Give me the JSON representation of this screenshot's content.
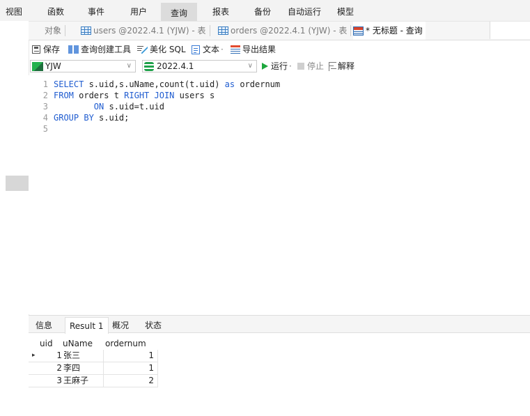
{
  "menubar": {
    "items": [
      "视图",
      "函数",
      "事件",
      "用户",
      "查询",
      "报表",
      "备份",
      "自动运行",
      "模型"
    ],
    "active_index": 4
  },
  "tabs": {
    "object_label": "对象",
    "items": [
      {
        "label": "users @2022.4.1 (YJW) - 表",
        "icon": "table-icon"
      },
      {
        "label": "orders @2022.4.1 (YJW) - 表",
        "icon": "table-icon"
      },
      {
        "label": "* 无标题 - 查询",
        "icon": "query-icon"
      }
    ]
  },
  "toolbar": {
    "save": "保存",
    "query_builder": "查询创建工具",
    "beautify": "美化 SQL",
    "text": "文本",
    "export": "导出结果"
  },
  "connection": {
    "connection_value": "YJW",
    "database_value": "2022.4.1",
    "run": "运行",
    "stop": "停止",
    "explain": "解释"
  },
  "editor": {
    "lines": [
      {
        "num": "1",
        "tokens": [
          [
            "kw",
            "SELECT"
          ],
          [
            "pl",
            " s.uid,s.uName,count(t.uid) "
          ],
          [
            "kw",
            "as"
          ],
          [
            "pl",
            " ordernum"
          ]
        ]
      },
      {
        "num": "2",
        "tokens": [
          [
            "kw",
            "FROM"
          ],
          [
            "pl",
            " orders t "
          ],
          [
            "kw",
            "RIGHT JOIN"
          ],
          [
            "pl",
            " users s"
          ]
        ]
      },
      {
        "num": "3",
        "tokens": [
          [
            "pl",
            "        "
          ],
          [
            "kw",
            "ON"
          ],
          [
            "pl",
            " s.uid=t.uid"
          ]
        ]
      },
      {
        "num": "4",
        "tokens": [
          [
            "kw",
            "GROUP BY"
          ],
          [
            "pl",
            " s.uid;"
          ]
        ]
      },
      {
        "num": "5",
        "tokens": []
      }
    ]
  },
  "results": {
    "tabs": [
      "信息",
      "Result 1",
      "概况",
      "状态"
    ],
    "active_tab": 1,
    "columns": [
      "uid",
      "uName",
      "ordernum"
    ],
    "rows": [
      [
        "1",
        "张三",
        "1"
      ],
      [
        "2",
        "李四",
        "1"
      ],
      [
        "3",
        "王麻子",
        "2"
      ]
    ],
    "current_row_marker": "▸"
  },
  "colors": {
    "keyword": "#1f5cd0",
    "run_green": "#1ea83e",
    "active_menu_bg": "#dcdcdc"
  }
}
